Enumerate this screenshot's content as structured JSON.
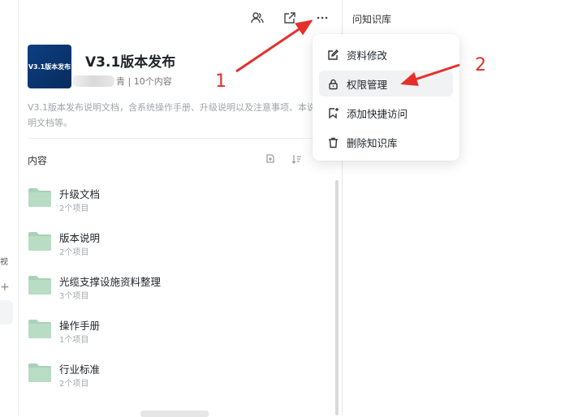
{
  "right_panel": {
    "title": "问知识库"
  },
  "knowledge_base": {
    "cover_text": "V3.1版本发布",
    "title": "V3.1版本发布",
    "meta_suffix": "青 | 10个内容",
    "description": "V3.1版本发布说明文档，含系统操作手册、升级说明以及注意事项、本说明文档等。"
  },
  "content": {
    "heading": "内容",
    "folders": [
      {
        "name": "升级文档",
        "count": "2个项目"
      },
      {
        "name": "版本说明",
        "count": "2个项目"
      },
      {
        "name": "光缆支撑设施资料整理",
        "count": "3个项目"
      },
      {
        "name": "操作手册",
        "count": "1个项目"
      },
      {
        "name": "行业标准",
        "count": "2个项目"
      }
    ]
  },
  "left_strip": {
    "cut_text": "视",
    "cut_plus": "+"
  },
  "menu": {
    "items": [
      {
        "label": "资料修改",
        "icon": "edit-icon"
      },
      {
        "label": "权限管理",
        "icon": "lock-icon"
      },
      {
        "label": "添加快捷访问",
        "icon": "bookmark-star-icon"
      },
      {
        "label": "删除知识库",
        "icon": "trash-icon"
      }
    ]
  },
  "annotations": {
    "label_1": "1",
    "label_2": "2",
    "color": "#e5302a"
  },
  "colors": {
    "folder": "#b9dcc5",
    "folder_tab": "#a8d2b7",
    "cover": "#0d3f82"
  }
}
